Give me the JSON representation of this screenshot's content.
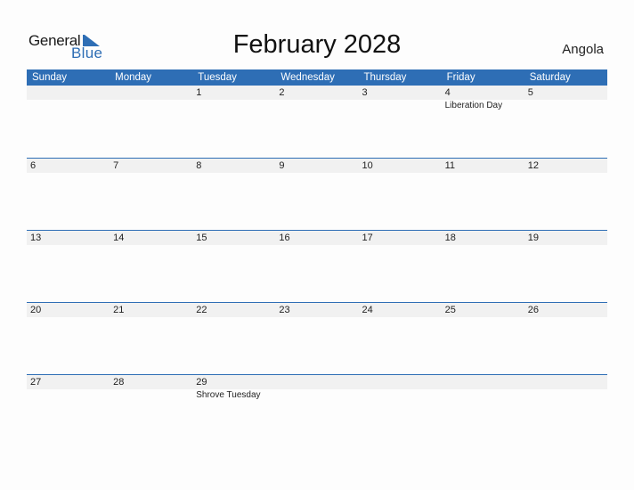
{
  "logo": {
    "general": "General",
    "blue": "Blue"
  },
  "title": "February 2028",
  "country": "Angola",
  "weekdays": [
    "Sunday",
    "Monday",
    "Tuesday",
    "Wednesday",
    "Thursday",
    "Friday",
    "Saturday"
  ],
  "weeks": [
    [
      {
        "d": ""
      },
      {
        "d": ""
      },
      {
        "d": "1"
      },
      {
        "d": "2"
      },
      {
        "d": "3"
      },
      {
        "d": "4",
        "h": "Liberation Day"
      },
      {
        "d": "5"
      }
    ],
    [
      {
        "d": "6"
      },
      {
        "d": "7"
      },
      {
        "d": "8"
      },
      {
        "d": "9"
      },
      {
        "d": "10"
      },
      {
        "d": "11"
      },
      {
        "d": "12"
      }
    ],
    [
      {
        "d": "13"
      },
      {
        "d": "14"
      },
      {
        "d": "15"
      },
      {
        "d": "16"
      },
      {
        "d": "17"
      },
      {
        "d": "18"
      },
      {
        "d": "19"
      }
    ],
    [
      {
        "d": "20"
      },
      {
        "d": "21"
      },
      {
        "d": "22"
      },
      {
        "d": "23"
      },
      {
        "d": "24"
      },
      {
        "d": "25"
      },
      {
        "d": "26"
      }
    ],
    [
      {
        "d": "27"
      },
      {
        "d": "28"
      },
      {
        "d": "29",
        "h": "Shrove Tuesday"
      },
      {
        "d": ""
      },
      {
        "d": ""
      },
      {
        "d": ""
      },
      {
        "d": ""
      }
    ]
  ],
  "colors": {
    "accent": "#2e6eb5",
    "row_bg": "#f1f1f1"
  }
}
